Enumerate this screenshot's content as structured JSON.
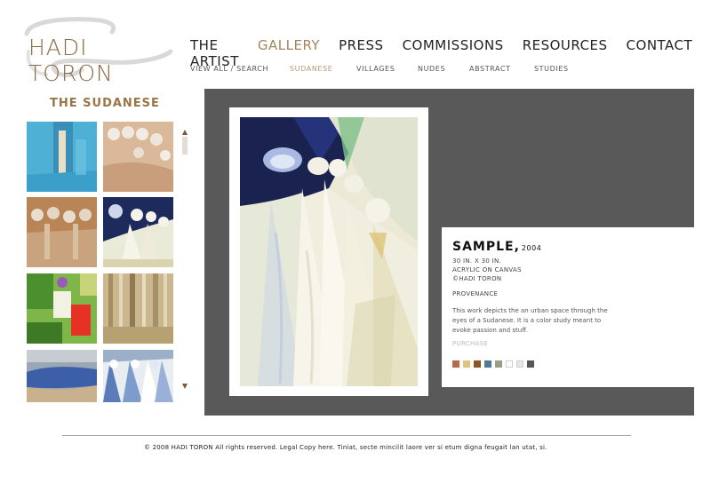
{
  "logo": {
    "text": "HADI TORON"
  },
  "nav": {
    "items": [
      {
        "label": "THE ARTIST"
      },
      {
        "label": "GALLERY"
      },
      {
        "label": "PRESS"
      },
      {
        "label": "COMMISSIONS"
      },
      {
        "label": "RESOURCES"
      },
      {
        "label": "CONTACT"
      }
    ],
    "active": "GALLERY"
  },
  "subnav": {
    "items": [
      {
        "label": "VIEW ALL / SEARCH"
      },
      {
        "label": "SUDANESE"
      },
      {
        "label": "VILLAGES"
      },
      {
        "label": "NUDES"
      },
      {
        "label": "ABSTRACT"
      },
      {
        "label": "STUDIES"
      }
    ],
    "active": "SUDANESE"
  },
  "sidebar": {
    "title": "THE SUDANESE",
    "thumbnails": [
      "abstract-blue-painting",
      "figures-painting",
      "figures-painting",
      "figures-dark-blue-painting",
      "colorful-abstract-painting",
      "figures-vertical-painting",
      "blue-abstract-painting",
      "figures-blue-painting"
    ]
  },
  "artwork": {
    "title": "SAMPLE,",
    "year": "2004",
    "size": "30 IN. X 30 IN.",
    "medium": "ACRYLIC ON CANVAS",
    "credit": "©HADI TORON",
    "provenance_label": "PROVENANCE",
    "description": "This work depicts the an urban space through the eyes of a Sudanese. It is a color study meant to evoke passion and stuff.",
    "purchase_label": "PURCHASE",
    "swatches": [
      "#b86a4f",
      "#e2c27f",
      "#8a5424",
      "#52779c",
      "#9c9c86",
      "#ffffff",
      "#e6e6e6",
      "#555555"
    ]
  },
  "footer": {
    "text": "© 2008 HADI TORON All rights reserved. Legal Copy here. Tiniat, secte mincilit laore ver si etum digna feugait lan utat, si."
  },
  "colors": {
    "brand_brown": "#9a7544",
    "active_nav": "#a3865d",
    "viewer_bg": "#595959"
  }
}
